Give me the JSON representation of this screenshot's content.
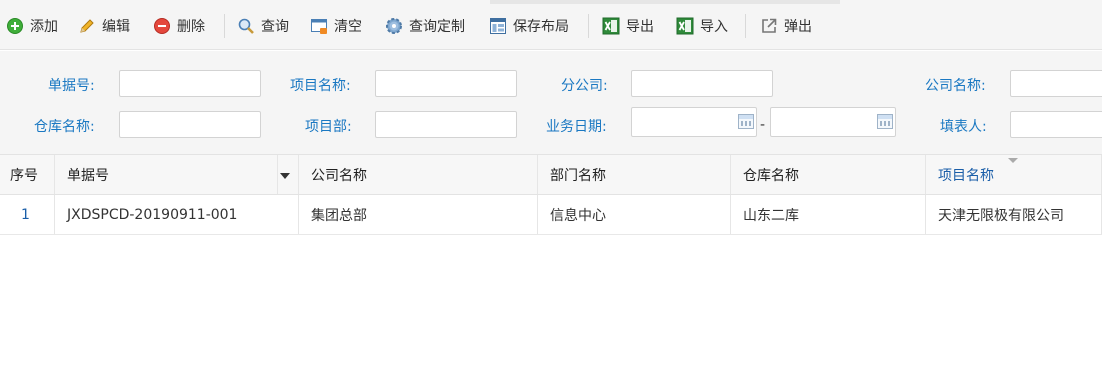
{
  "toolbar": {
    "add": "添加",
    "edit": "编辑",
    "delete": "删除",
    "query": "查询",
    "clear": "清空",
    "custom_query": "查询定制",
    "save_layout": "保存布局",
    "export": "导出",
    "import": "导入",
    "popup": "弹出"
  },
  "icons": {
    "add": "plus-circle-icon",
    "edit": "pencil-icon",
    "delete": "minus-circle-icon",
    "query": "magnifier-icon",
    "clear": "clear-form-icon",
    "custom_query": "gear-icon",
    "save_layout": "layout-icon",
    "export": "excel-icon",
    "import": "excel-icon",
    "popup": "external-link-icon"
  },
  "form": {
    "doc_no_label": "单据号:",
    "project_name_label": "项目名称:",
    "branch_label": "分公司:",
    "company_name_label": "公司名称:",
    "warehouse_label": "仓库名称:",
    "project_dept_label": "项目部:",
    "business_date_label": "业务日期:",
    "filler_label": "填表人:",
    "date_separator": "-",
    "values": {
      "doc_no": "",
      "project_name": "",
      "branch": "",
      "company_name": "",
      "warehouse": "",
      "project_dept": "",
      "date_from": "",
      "date_to": "",
      "filler": ""
    }
  },
  "table": {
    "columns": [
      "序号",
      "单据号",
      "公司名称",
      "部门名称",
      "仓库名称",
      "项目名称"
    ],
    "rows": [
      [
        "1",
        "JXDSPCD-20190911-001",
        "集团总部",
        "信息中心",
        "山东二库",
        "天津无限极有限公司"
      ]
    ]
  },
  "colors": {
    "label_blue": "#1a78c2",
    "header_active": "#1a5ea8",
    "toolbar_bg": "#f5f5f5"
  }
}
